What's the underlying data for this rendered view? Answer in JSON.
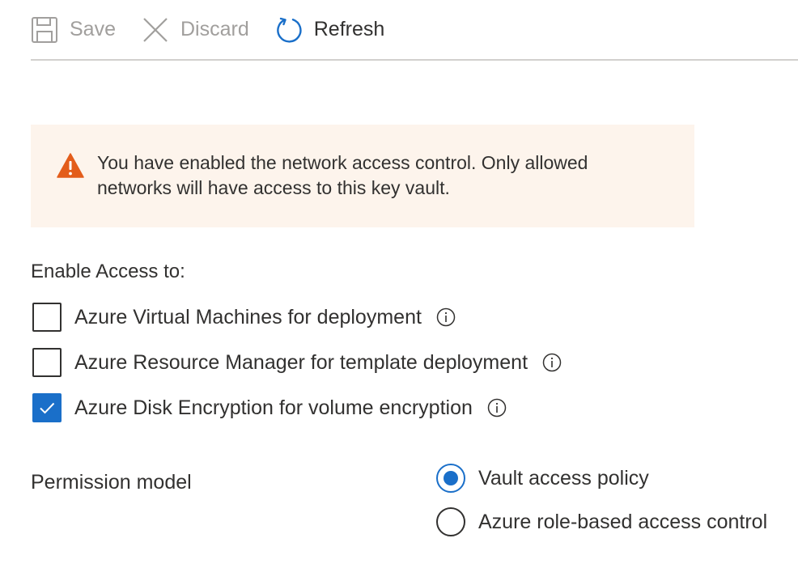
{
  "toolbar": {
    "save_label": "Save",
    "discard_label": "Discard",
    "refresh_label": "Refresh"
  },
  "banner": {
    "icon": "warning-icon",
    "message_line1": "You have enabled the network access control. Only allowed",
    "message_line2": "networks will have access to this key vault."
  },
  "access": {
    "label": "Enable Access to:",
    "options": [
      {
        "label": "Azure Virtual Machines for deployment",
        "checked": false
      },
      {
        "label": "Azure Resource Manager for template deployment",
        "checked": false
      },
      {
        "label": "Azure Disk Encryption for volume encryption",
        "checked": true
      }
    ]
  },
  "permission": {
    "label": "Permission model",
    "options": [
      {
        "label": "Vault access policy",
        "selected": true
      },
      {
        "label": "Azure role-based access control",
        "selected": false
      }
    ]
  },
  "colors": {
    "accent": "#1a6fc9",
    "warning": "#e35d1b",
    "banner_bg": "#fdf4ec",
    "disabled_text": "#a19f9d"
  }
}
